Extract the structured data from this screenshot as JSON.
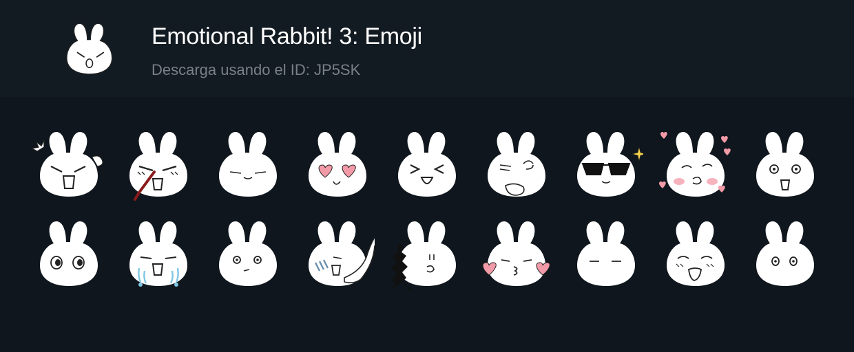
{
  "pack": {
    "title": "Emotional Rabbit! 3: Emoji",
    "subtitle": "Descarga usando el ID: JP5SK",
    "icon": "rabbit-icon"
  },
  "stickers": [
    {
      "name": "sticker-angry-puff",
      "expression": "angry"
    },
    {
      "name": "sticker-nosebleed",
      "expression": "nosebleed"
    },
    {
      "name": "sticker-smug",
      "expression": "smug"
    },
    {
      "name": "sticker-heart-eyes",
      "expression": "heart-eyes"
    },
    {
      "name": "sticker-laughing",
      "expression": "laughing"
    },
    {
      "name": "sticker-thinking",
      "expression": "thinking"
    },
    {
      "name": "sticker-sunglasses",
      "expression": "sunglasses"
    },
    {
      "name": "sticker-in-love",
      "expression": "in-love"
    },
    {
      "name": "sticker-shocked",
      "expression": "shocked"
    },
    {
      "name": "sticker-wide-eyes",
      "expression": "wide-eyes"
    },
    {
      "name": "sticker-crying",
      "expression": "crying"
    },
    {
      "name": "sticker-unimpressed",
      "expression": "unimpressed"
    },
    {
      "name": "sticker-shy-wave",
      "expression": "shy-wave"
    },
    {
      "name": "sticker-crumbling",
      "expression": "crumbling"
    },
    {
      "name": "sticker-kiss",
      "expression": "kiss"
    },
    {
      "name": "sticker-blank",
      "expression": "blank"
    },
    {
      "name": "sticker-drooling",
      "expression": "drooling"
    },
    {
      "name": "sticker-plain",
      "expression": "plain"
    }
  ]
}
